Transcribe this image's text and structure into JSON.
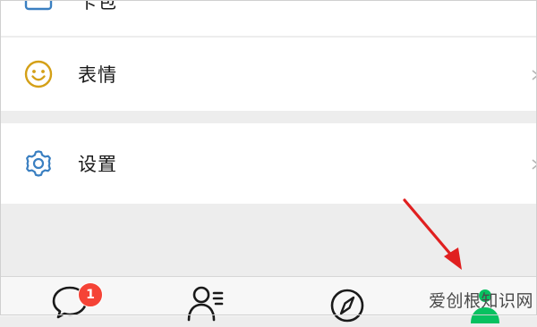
{
  "menu": {
    "items": [
      {
        "label": "卡包",
        "icon": "card-wallet-icon"
      },
      {
        "label": "表情",
        "icon": "smiley-face-icon"
      },
      {
        "label": "设置",
        "icon": "gear-icon"
      }
    ]
  },
  "tabbar": {
    "tabs": [
      {
        "name": "chats",
        "icon": "chat-bubble-icon",
        "badge": "1"
      },
      {
        "name": "contacts",
        "icon": "contacts-icon"
      },
      {
        "name": "discover",
        "icon": "compass-icon"
      },
      {
        "name": "me",
        "icon": "person-icon",
        "active": true
      }
    ]
  },
  "colors": {
    "accent_green": "#07c160",
    "emoji_icon": "#d4a017",
    "settings_icon": "#3a7fc1",
    "badge_red": "#f54336",
    "annotation_arrow": "#e02020"
  },
  "watermark": "爱创根知识网"
}
